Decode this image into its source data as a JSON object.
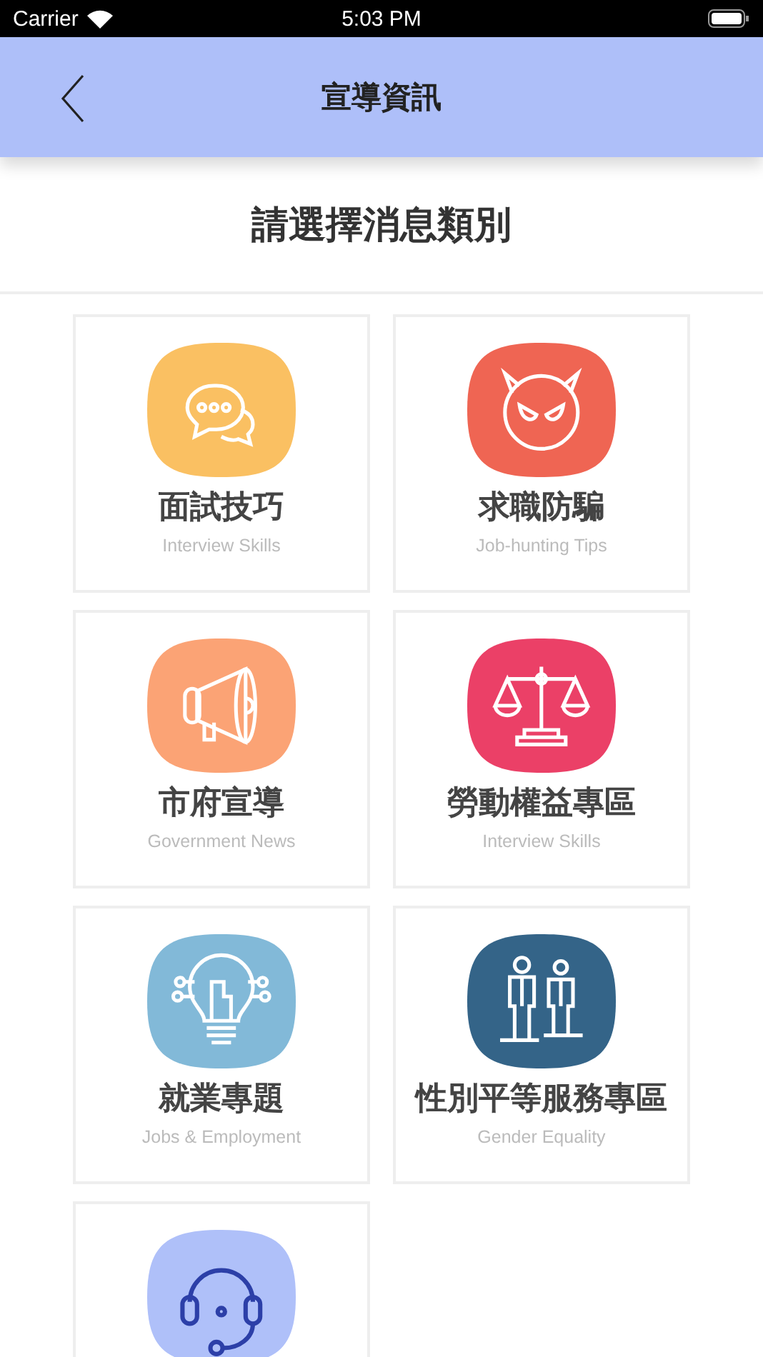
{
  "status_bar": {
    "carrier": "Carrier",
    "time": "5:03 PM"
  },
  "nav_bar": {
    "title": "宣導資訊"
  },
  "heading": "請選擇消息類別",
  "categories": [
    {
      "kind": "chat",
      "color": "#fac062",
      "title": "面試技巧",
      "subtitle": "Interview Skills"
    },
    {
      "kind": "devil",
      "color": "#ef6553",
      "title": "求職防騙",
      "subtitle": "Job-hunting Tips"
    },
    {
      "kind": "megaphone",
      "color": "#fba375",
      "title": "市府宣導",
      "subtitle": "Government News"
    },
    {
      "kind": "scales",
      "color": "#eb4067",
      "title": "勞動權益專區",
      "subtitle": "Interview Skills"
    },
    {
      "kind": "bulb",
      "color": "#82b9d8",
      "title": "就業專題",
      "subtitle": "Jobs & Employment"
    },
    {
      "kind": "people",
      "color": "#346488",
      "title": "性別平等服務專區",
      "subtitle": "Gender Equality"
    },
    {
      "kind": "headset",
      "color": "#afc0f9"
    }
  ]
}
